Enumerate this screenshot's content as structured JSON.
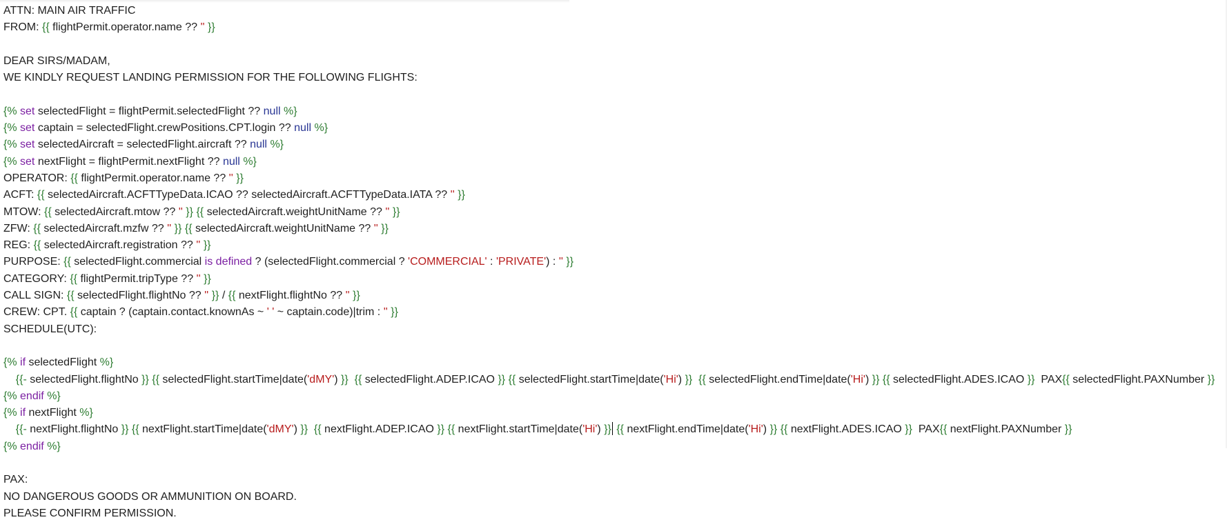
{
  "editor": {
    "lines": [
      [
        [
          "text",
          "ATTN: MAIN AIR TRAFFIC"
        ]
      ],
      [
        [
          "text",
          "FROM: "
        ],
        [
          "delim",
          "{{"
        ],
        [
          "text",
          " flightPermit.operator.name ?? "
        ],
        [
          "str",
          "''"
        ],
        [
          "text",
          " "
        ],
        [
          "delim",
          "}}"
        ]
      ],
      [],
      [
        [
          "text",
          "DEAR SIRS/MADAM,"
        ]
      ],
      [
        [
          "text",
          "WE KINDLY REQUEST LANDING PERMISSION FOR THE FOLLOWING FLIGHTS:"
        ]
      ],
      [],
      [
        [
          "delim",
          "{%"
        ],
        [
          "text",
          " "
        ],
        [
          "kw",
          "set"
        ],
        [
          "text",
          " selectedFlight = flightPermit.selectedFlight ?? "
        ],
        [
          "const",
          "null"
        ],
        [
          "text",
          " "
        ],
        [
          "delim",
          "%}"
        ]
      ],
      [
        [
          "delim",
          "{%"
        ],
        [
          "text",
          " "
        ],
        [
          "kw",
          "set"
        ],
        [
          "text",
          " captain = selectedFlight.crewPositions.CPT.login ?? "
        ],
        [
          "const",
          "null"
        ],
        [
          "text",
          " "
        ],
        [
          "delim",
          "%}"
        ]
      ],
      [
        [
          "delim",
          "{%"
        ],
        [
          "text",
          " "
        ],
        [
          "kw",
          "set"
        ],
        [
          "text",
          " selectedAircraft = selectedFlight.aircraft ?? "
        ],
        [
          "const",
          "null"
        ],
        [
          "text",
          " "
        ],
        [
          "delim",
          "%}"
        ]
      ],
      [
        [
          "delim",
          "{%"
        ],
        [
          "text",
          " "
        ],
        [
          "kw",
          "set"
        ],
        [
          "text",
          " nextFlight = flightPermit.nextFlight ?? "
        ],
        [
          "const",
          "null"
        ],
        [
          "text",
          " "
        ],
        [
          "delim",
          "%}"
        ]
      ],
      [
        [
          "text",
          "OPERATOR: "
        ],
        [
          "delim",
          "{{"
        ],
        [
          "text",
          " flightPermit.operator.name ?? "
        ],
        [
          "str",
          "''"
        ],
        [
          "text",
          " "
        ],
        [
          "delim",
          "}}"
        ]
      ],
      [
        [
          "text",
          "ACFT: "
        ],
        [
          "delim",
          "{{"
        ],
        [
          "text",
          " selectedAircraft.ACFTTypeData.ICAO ?? selectedAircraft.ACFTTypeData.IATA ?? "
        ],
        [
          "str",
          "''"
        ],
        [
          "text",
          " "
        ],
        [
          "delim",
          "}}"
        ]
      ],
      [
        [
          "text",
          "MTOW: "
        ],
        [
          "delim",
          "{{"
        ],
        [
          "text",
          " selectedAircraft.mtow ?? "
        ],
        [
          "str",
          "''"
        ],
        [
          "text",
          " "
        ],
        [
          "delim",
          "}}"
        ],
        [
          "text",
          " "
        ],
        [
          "delim",
          "{{"
        ],
        [
          "text",
          " selectedAircraft.weightUnitName ?? "
        ],
        [
          "str",
          "''"
        ],
        [
          "text",
          " "
        ],
        [
          "delim",
          "}}"
        ]
      ],
      [
        [
          "text",
          "ZFW: "
        ],
        [
          "delim",
          "{{"
        ],
        [
          "text",
          " selectedAircraft.mzfw ?? "
        ],
        [
          "str",
          "''"
        ],
        [
          "text",
          " "
        ],
        [
          "delim",
          "}}"
        ],
        [
          "text",
          " "
        ],
        [
          "delim",
          "{{"
        ],
        [
          "text",
          " selectedAircraft.weightUnitName ?? "
        ],
        [
          "str",
          "''"
        ],
        [
          "text",
          " "
        ],
        [
          "delim",
          "}}"
        ]
      ],
      [
        [
          "text",
          "REG: "
        ],
        [
          "delim",
          "{{"
        ],
        [
          "text",
          " selectedAircraft.registration ?? "
        ],
        [
          "str",
          "''"
        ],
        [
          "text",
          " "
        ],
        [
          "delim",
          "}}"
        ]
      ],
      [
        [
          "text",
          "PURPOSE: "
        ],
        [
          "delim",
          "{{"
        ],
        [
          "text",
          " selectedFlight.commercial "
        ],
        [
          "kw",
          "is defined"
        ],
        [
          "text",
          " ? (selectedFlight.commercial ? "
        ],
        [
          "str",
          "'COMMERCIAL'"
        ],
        [
          "text",
          " : "
        ],
        [
          "str",
          "'PRIVATE'"
        ],
        [
          "text",
          ") : "
        ],
        [
          "str",
          "''"
        ],
        [
          "text",
          " "
        ],
        [
          "delim",
          "}}"
        ]
      ],
      [
        [
          "text",
          "CATEGORY: "
        ],
        [
          "delim",
          "{{"
        ],
        [
          "text",
          " flightPermit.tripType ?? "
        ],
        [
          "str",
          "''"
        ],
        [
          "text",
          " "
        ],
        [
          "delim",
          "}}"
        ]
      ],
      [
        [
          "text",
          "CALL SIGN: "
        ],
        [
          "delim",
          "{{"
        ],
        [
          "text",
          " selectedFlight.flightNo ?? "
        ],
        [
          "str",
          "''"
        ],
        [
          "text",
          " "
        ],
        [
          "delim",
          "}}"
        ],
        [
          "text",
          " / "
        ],
        [
          "delim",
          "{{"
        ],
        [
          "text",
          " nextFlight.flightNo ?? "
        ],
        [
          "str",
          "''"
        ],
        [
          "text",
          " "
        ],
        [
          "delim",
          "}}"
        ]
      ],
      [
        [
          "text",
          "CREW: CPT. "
        ],
        [
          "delim",
          "{{"
        ],
        [
          "text",
          " captain ? (captain.contact.knownAs ~ "
        ],
        [
          "str",
          "' '"
        ],
        [
          "text",
          " ~ captain.code)|trim : "
        ],
        [
          "str",
          "''"
        ],
        [
          "text",
          " "
        ],
        [
          "delim",
          "}}"
        ]
      ],
      [
        [
          "text",
          "SCHEDULE(UTC):"
        ]
      ],
      [],
      [
        [
          "delim",
          "{%"
        ],
        [
          "text",
          " "
        ],
        [
          "kw",
          "if"
        ],
        [
          "text",
          " selectedFlight "
        ],
        [
          "delim",
          "%}"
        ]
      ],
      [
        [
          "text",
          "    "
        ],
        [
          "delim",
          "{{-"
        ],
        [
          "text",
          " selectedFlight.flightNo "
        ],
        [
          "delim",
          "}}"
        ],
        [
          "text",
          " "
        ],
        [
          "delim",
          "{{"
        ],
        [
          "text",
          " selectedFlight.startTime|date("
        ],
        [
          "str",
          "'dMY'"
        ],
        [
          "text",
          ") "
        ],
        [
          "delim",
          "}}"
        ],
        [
          "text",
          "  "
        ],
        [
          "delim",
          "{{"
        ],
        [
          "text",
          " selectedFlight.ADEP.ICAO "
        ],
        [
          "delim",
          "}}"
        ],
        [
          "text",
          " "
        ],
        [
          "delim",
          "{{"
        ],
        [
          "text",
          " selectedFlight.startTime|date("
        ],
        [
          "str",
          "'Hi'"
        ],
        [
          "text",
          ") "
        ],
        [
          "delim",
          "}}"
        ],
        [
          "text",
          "  "
        ],
        [
          "delim",
          "{{"
        ],
        [
          "text",
          " selectedFlight.endTime|date("
        ],
        [
          "str",
          "'Hi'"
        ],
        [
          "text",
          ") "
        ],
        [
          "delim",
          "}}"
        ],
        [
          "text",
          " "
        ],
        [
          "delim",
          "{{"
        ],
        [
          "text",
          " selectedFlight.ADES.ICAO "
        ],
        [
          "delim",
          "}}"
        ],
        [
          "text",
          "  PAX"
        ],
        [
          "delim",
          "{{"
        ],
        [
          "text",
          " selectedFlight.PAXNumber "
        ],
        [
          "delim",
          "}}"
        ]
      ],
      [
        [
          "delim",
          "{%"
        ],
        [
          "text",
          " "
        ],
        [
          "kw",
          "endif"
        ],
        [
          "text",
          " "
        ],
        [
          "delim",
          "%}"
        ]
      ],
      [
        [
          "delim",
          "{%"
        ],
        [
          "text",
          " "
        ],
        [
          "kw",
          "if"
        ],
        [
          "text",
          " nextFlight "
        ],
        [
          "delim",
          "%}"
        ]
      ],
      [
        [
          "text",
          "    "
        ],
        [
          "delim",
          "{{-"
        ],
        [
          "text",
          " nextFlight.flightNo "
        ],
        [
          "delim",
          "}}"
        ],
        [
          "text",
          " "
        ],
        [
          "delim",
          "{{"
        ],
        [
          "text",
          " nextFlight.startTime|date("
        ],
        [
          "str",
          "'dMY'"
        ],
        [
          "text",
          ") "
        ],
        [
          "delim",
          "}}"
        ],
        [
          "text",
          "  "
        ],
        [
          "delim",
          "{{"
        ],
        [
          "text",
          " nextFlight.ADEP.ICAO "
        ],
        [
          "delim",
          "}}"
        ],
        [
          "text",
          " "
        ],
        [
          "delim",
          "{{"
        ],
        [
          "text",
          " nextFlight.startTime|date("
        ],
        [
          "str",
          "'Hi'"
        ],
        [
          "text",
          ") "
        ],
        [
          "delim",
          "}}"
        ],
        [
          "caret",
          ""
        ],
        [
          "text",
          " "
        ],
        [
          "delim",
          "{{"
        ],
        [
          "text",
          " nextFlight.endTime|date("
        ],
        [
          "str",
          "'Hi'"
        ],
        [
          "text",
          ") "
        ],
        [
          "delim",
          "}}"
        ],
        [
          "text",
          " "
        ],
        [
          "delim",
          "{{"
        ],
        [
          "text",
          " nextFlight.ADES.ICAO "
        ],
        [
          "delim",
          "}}"
        ],
        [
          "text",
          "  PAX"
        ],
        [
          "delim",
          "{{"
        ],
        [
          "text",
          " nextFlight.PAXNumber "
        ],
        [
          "delim",
          "}}"
        ]
      ],
      [
        [
          "delim",
          "{%"
        ],
        [
          "text",
          " "
        ],
        [
          "kw",
          "endif"
        ],
        [
          "text",
          " "
        ],
        [
          "delim",
          "%}"
        ]
      ],
      [],
      [
        [
          "text",
          "PAX:"
        ]
      ],
      [
        [
          "text",
          "NO DANGEROUS GOODS OR AMMUNITION ON BOARD."
        ]
      ],
      [
        [
          "text",
          "PLEASE CONFIRM PERMISSION."
        ]
      ]
    ]
  }
}
